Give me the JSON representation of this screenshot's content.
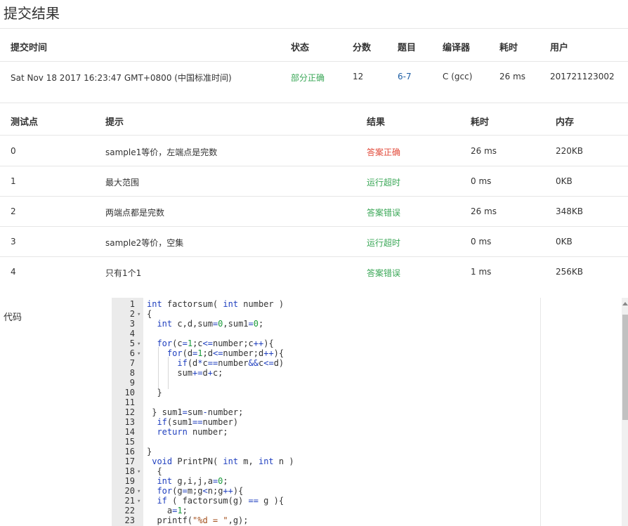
{
  "page_title": "提交结果",
  "summary": {
    "headers": {
      "time": "提交时间",
      "status": "状态",
      "score": "分数",
      "problem": "题目",
      "compiler": "编译器",
      "elapsed": "耗时",
      "user": "用户"
    },
    "row": {
      "time": "Sat Nov 18 2017 16:23:47 GMT+0800 (中国标准时间)",
      "status": "部分正确",
      "score": "12",
      "problem": "6-7",
      "compiler": "C (gcc)",
      "elapsed": "26 ms",
      "user": "201721123002"
    }
  },
  "tests": {
    "headers": {
      "point": "测试点",
      "hint": "提示",
      "result": "结果",
      "elapsed": "耗时",
      "memory": "内存"
    },
    "rows": [
      {
        "point": "0",
        "hint": "sample1等价，左端点是完数",
        "result": "答案正确",
        "elapsed": "26 ms",
        "memory": "220KB"
      },
      {
        "point": "1",
        "hint": "最大范围",
        "result": "运行超时",
        "elapsed": "0 ms",
        "memory": "0KB"
      },
      {
        "point": "2",
        "hint": "两端点都是完数",
        "result": "答案错误",
        "elapsed": "26 ms",
        "memory": "348KB"
      },
      {
        "point": "3",
        "hint": "sample2等价，空集",
        "result": "运行超时",
        "elapsed": "0 ms",
        "memory": "0KB"
      },
      {
        "point": "4",
        "hint": "只有1个1",
        "result": "答案错误",
        "elapsed": "1 ms",
        "memory": "256KB"
      }
    ]
  },
  "code_label": "代码",
  "code_lines": [
    "int factorsum( int number )",
    "{",
    "  int c,d,sum=0,sum1=0;",
    "",
    "  for(c=1;c<=number;c++){",
    "    for(d=1;d<=number;d++){",
    "      if(d*c==number&&c<=d)",
    "      sum+=d+c;",
    "",
    "  }",
    "",
    " } sum1=sum-number;",
    "  if(sum1==number)",
    "  return number;",
    "",
    "}",
    " void PrintPN( int m, int n )",
    "  {",
    "  int g,i,j,a=0;",
    "  for(g=m;g<n;g++){",
    "  if ( factorsum(g) == g ){",
    "    a=1;",
    "  printf(\"%d = \",g);"
  ],
  "fold_lines": [
    2,
    5,
    6,
    18,
    20,
    21
  ]
}
